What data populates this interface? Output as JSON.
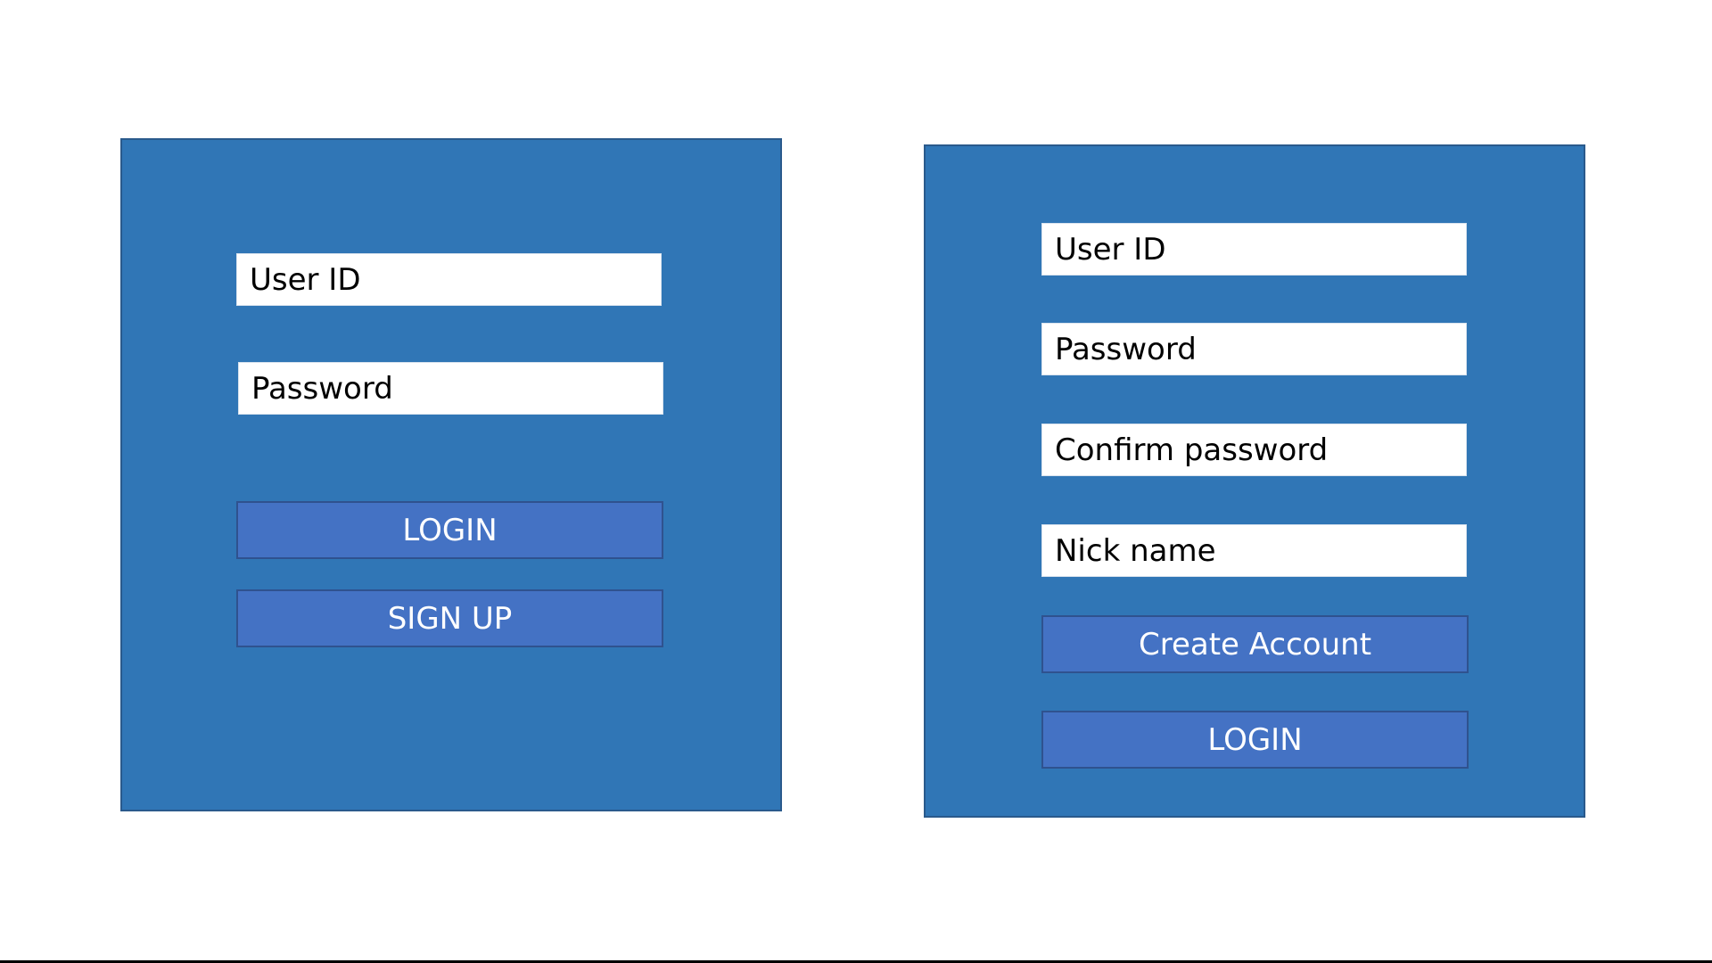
{
  "colors": {
    "panel_background": "#3076b6",
    "button_background": "#4472c4",
    "field_background": "#ffffff"
  },
  "login_panel": {
    "user_id_placeholder": "User ID",
    "password_placeholder": "Password",
    "login_button_label": "LOGIN",
    "signup_button_label": "SIGN UP"
  },
  "signup_panel": {
    "user_id_placeholder": "User ID",
    "password_placeholder": "Password",
    "confirm_password_placeholder": "Confirm password",
    "nickname_placeholder": "Nick name",
    "create_account_button_label": "Create Account",
    "login_button_label": "LOGIN"
  }
}
